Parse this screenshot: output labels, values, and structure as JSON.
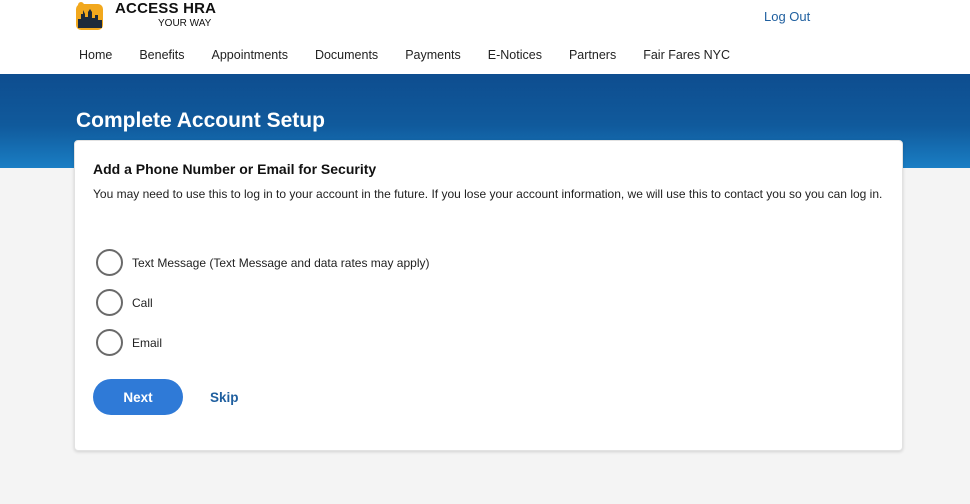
{
  "header": {
    "brand_title": "ACCESS HRA",
    "brand_subtitle": "YOUR WAY",
    "logout_label": "Log Out"
  },
  "nav": {
    "items": [
      "Home",
      "Benefits",
      "Appointments",
      "Documents",
      "Payments",
      "E-Notices",
      "Partners",
      "Fair Fares NYC"
    ]
  },
  "page": {
    "title": "Complete Account Setup"
  },
  "card": {
    "title": "Add a Phone Number or Email for Security",
    "description": "You may need to use this to log in to your account in the future. If you lose your account information, we will use this to contact you so you can log in.",
    "options": [
      {
        "label": "Text Message (Text Message and data rates may apply)",
        "selected": false
      },
      {
        "label": "Call",
        "selected": false
      },
      {
        "label": "Email",
        "selected": false
      }
    ],
    "next_label": "Next",
    "skip_label": "Skip"
  },
  "colors": {
    "banner": "#105a9c",
    "accent": "#2f7ad7",
    "link": "#1f5f9f"
  },
  "icons": {
    "logo": "access-hra-logo-icon"
  }
}
